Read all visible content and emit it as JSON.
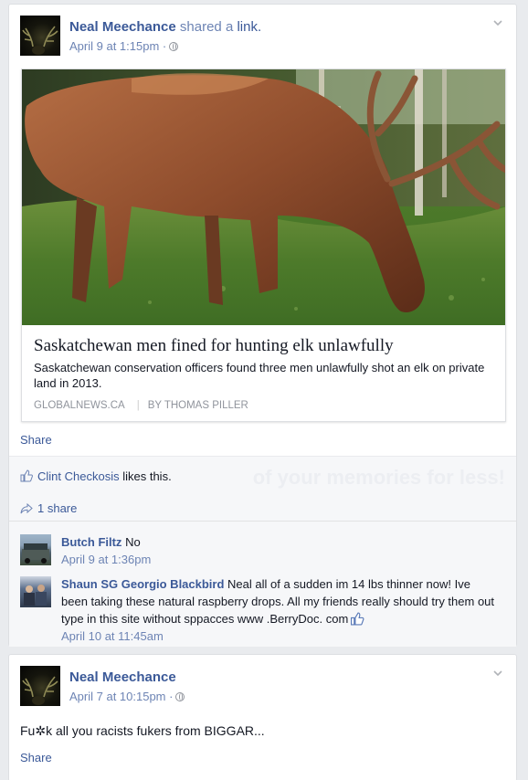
{
  "post1": {
    "author": "Neal Meechance",
    "action_prefix": "shared a",
    "action_link": "link.",
    "timestamp": "April 9 at 1:15pm",
    "preview": {
      "title": "Saskatchewan men fined for hunting elk unlawfully",
      "description": "Saskatchewan conservation officers found three men unlawfully shot an elk on private land in 2013.",
      "source": "GLOBALNEWS.CA",
      "byline": "BY THOMAS PILLER"
    },
    "share_label": "Share",
    "overlay_text": "of your memories for less!",
    "likes": {
      "name": "Clint Checkosis",
      "suffix": "likes this."
    },
    "shares": "1 share",
    "comments": [
      {
        "author": "Butch Filtz",
        "text": "No",
        "timestamp": "April 9 at 1:36pm"
      },
      {
        "author": "Shaun SG Georgio Blackbird",
        "text": "Neal all of a sudden im 14 lbs thinner now! Ive been taking these natural raspberry drops. All my friends really should try them out type in this site without sppacces www .BerryDoc. com",
        "timestamp": "April 10 at 11:45am"
      }
    ]
  },
  "post2": {
    "author": "Neal Meechance",
    "timestamp": "April 7 at 10:15pm",
    "body": "Fu✲k all you racists fukers from BIGGAR...",
    "share_label": "Share"
  },
  "icons": {
    "chevron": "chevron-down-icon",
    "globe": "globe-icon",
    "thumb": "thumbs-up-icon",
    "share": "share-arrow-icon"
  },
  "colors": {
    "link": "#3b5998",
    "meta": "#6d84b4",
    "page_bg": "#e9ebee",
    "feedback_bg": "#f6f7f9"
  }
}
